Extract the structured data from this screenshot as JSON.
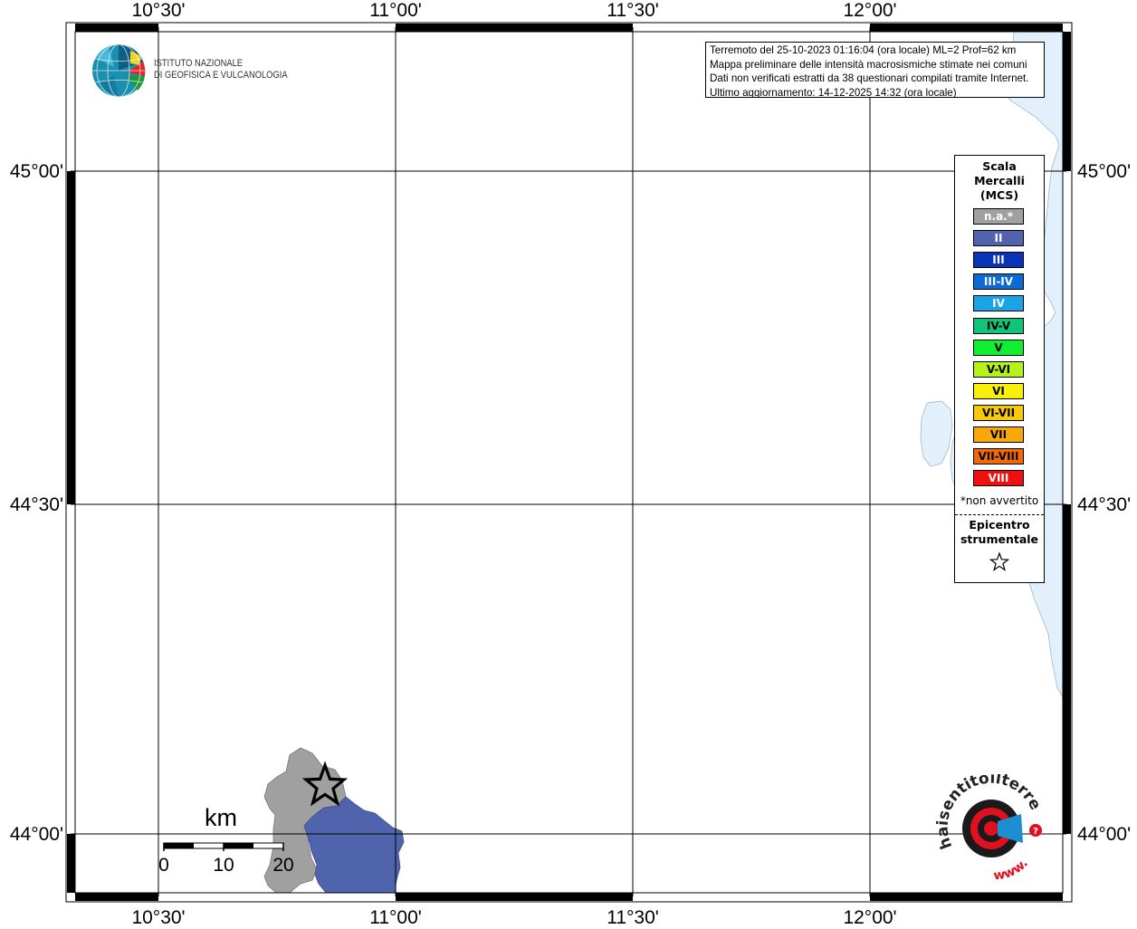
{
  "map": {
    "lon_ticks": [
      "10°30'",
      "11°00'",
      "11°30'",
      "12°00'"
    ],
    "lat_ticks": [
      "45°00'",
      "44°30'",
      "44°00'"
    ]
  },
  "info": {
    "line1": "Terremoto del 25-10-2023 01:16:04 (ora locale) ML=2 Prof=62 km",
    "line2": "Mappa preliminare delle intensità macrosismiche stimate nei comuni",
    "line3": "Dati non verificati estratti da 38 questionari compilati tramite Internet.",
    "line4": "Ultimo aggiornamento: 14-12-2025 14:32 (ora locale)"
  },
  "logo": {
    "line1": "ISTITUTO NAZIONALE",
    "line2": "DI GEOFISICA E VULCANOLOGIA"
  },
  "legend": {
    "title_l1": "Scala",
    "title_l2": "Mercalli",
    "title_l3": "(MCS)",
    "classes": [
      {
        "label": "n.a.*",
        "color": "#a0a0a0",
        "text_color": "#ffffff"
      },
      {
        "label": "II",
        "color": "#5064ad",
        "text_color": "#ffffff"
      },
      {
        "label": "III",
        "color": "#0a34b8",
        "text_color": "#ffffff"
      },
      {
        "label": "III-IV",
        "color": "#0a6bd2",
        "text_color": "#ffffff"
      },
      {
        "label": "IV",
        "color": "#1aa3e6",
        "text_color": "#ffffff"
      },
      {
        "label": "IV-V",
        "color": "#10c47a",
        "text_color": "#000000"
      },
      {
        "label": "V",
        "color": "#10f030",
        "text_color": "#000000"
      },
      {
        "label": "V-VI",
        "color": "#b4f21a",
        "text_color": "#000000"
      },
      {
        "label": "VI",
        "color": "#f8f00a",
        "text_color": "#000000"
      },
      {
        "label": "VI-VII",
        "color": "#f8c80a",
        "text_color": "#000000"
      },
      {
        "label": "VII",
        "color": "#f8a80a",
        "text_color": "#000000"
      },
      {
        "label": "VII-VIII",
        "color": "#f06a0a",
        "text_color": "#000000"
      },
      {
        "label": "VIII",
        "color": "#f01010",
        "text_color": "#ffffff"
      }
    ],
    "note": "*non avvertito",
    "epi_l1": "Epicentro",
    "epi_l2": "strumentale"
  },
  "scale": {
    "unit": "km",
    "labels": [
      "0",
      "10",
      "20"
    ]
  },
  "hst": {
    "text": "haisentitoilterremoto.it",
    "url": "www."
  }
}
